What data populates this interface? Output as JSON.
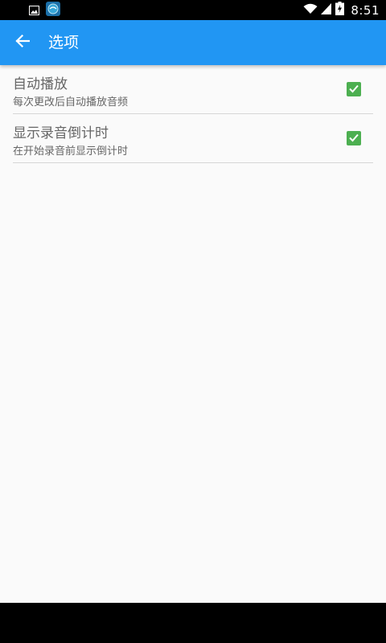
{
  "status_bar": {
    "time": "8:51",
    "icons": [
      "image-notification-icon",
      "app-notification-icon",
      "wifi-icon",
      "signal-icon",
      "battery-charging-icon"
    ]
  },
  "app_bar": {
    "title": "选项",
    "back_icon": "arrow-left-icon",
    "color": "#2196f3"
  },
  "settings": [
    {
      "title": "自动播放",
      "summary": "每次更改后自动播放音频",
      "checked": true
    },
    {
      "title": "显示录音倒计时",
      "summary": "在开始录音前显示倒计时",
      "checked": true
    }
  ],
  "colors": {
    "checkbox": "#4caf50",
    "background": "#fafafa"
  }
}
